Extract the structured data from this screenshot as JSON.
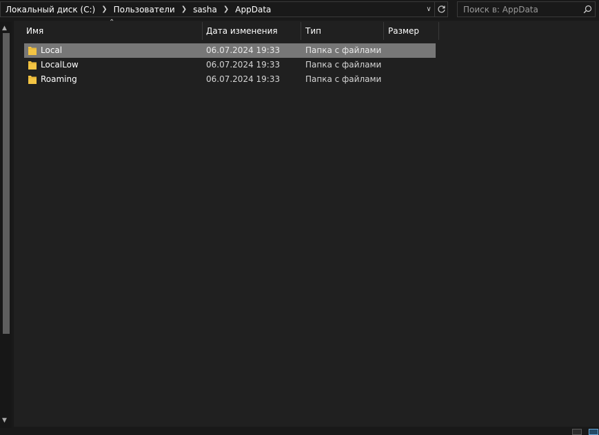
{
  "address": {
    "breadcrumbs": [
      "Локальный диск (C:)",
      "Пользователи",
      "sasha",
      "AppData"
    ]
  },
  "search": {
    "placeholder": "Поиск в: AppData"
  },
  "columns": {
    "name": "Имя",
    "date": "Дата изменения",
    "type": "Тип",
    "size": "Размер"
  },
  "files": [
    {
      "name": "Local",
      "date": "06.07.2024 19:33",
      "type": "Папка с файлами",
      "selected": true
    },
    {
      "name": "LocalLow",
      "date": "06.07.2024 19:33",
      "type": "Папка с файлами",
      "selected": false
    },
    {
      "name": "Roaming",
      "date": "06.07.2024 19:33",
      "type": "Папка с файлами",
      "selected": false
    }
  ],
  "icons": {
    "folder": "folder-icon",
    "breadcrumb_separator": "chevron-right-icon",
    "history": "chevron-down-icon",
    "refresh": "refresh-icon",
    "search": "search-icon",
    "sort": "sort-ascending-icon"
  },
  "colors": {
    "background": "#191919",
    "content_background": "#202020",
    "selection": "#777777",
    "folder": "#f3c443"
  }
}
